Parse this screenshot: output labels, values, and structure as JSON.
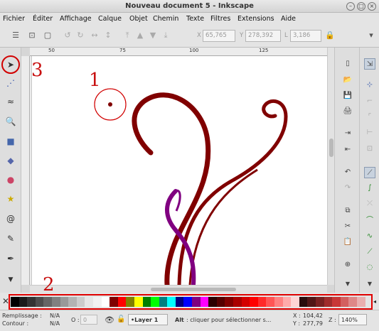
{
  "window": {
    "title": "Nouveau document 5 - Inkscape"
  },
  "menu": [
    "Fichier",
    "Éditer",
    "Affichage",
    "Calque",
    "Objet",
    "Chemin",
    "Texte",
    "Filtres",
    "Extensions",
    "Aide"
  ],
  "toolbar": {
    "x_label": "X",
    "x_value": "65,765",
    "y_label": "Y",
    "y_value": "278,392",
    "w_label": "L",
    "w_value": "3,186"
  },
  "ruler": {
    "ticks": [
      "50",
      "75",
      "100",
      "125"
    ]
  },
  "annotations": [
    "1",
    "2",
    "3"
  ],
  "palette": {
    "colors": [
      "#000000",
      "#1a1a1a",
      "#333333",
      "#4d4d4d",
      "#666666",
      "#808080",
      "#999999",
      "#b3b3b3",
      "#cccccc",
      "#e6e6e6",
      "#f2f2f2",
      "#ffffff",
      "#800000",
      "#ff0000",
      "#808000",
      "#ffff00",
      "#008000",
      "#00ff00",
      "#008080",
      "#00ffff",
      "#000080",
      "#0000ff",
      "#800080",
      "#ff00ff",
      "#2b0000",
      "#550000",
      "#800000",
      "#aa0000",
      "#d40000",
      "#ff0000",
      "#ff2a2a",
      "#ff5555",
      "#ff8080",
      "#ffaaaa",
      "#ffd5d5",
      "#280b0b",
      "#501616",
      "#782121",
      "#a02c2c",
      "#c83737",
      "#d35f5f",
      "#de8787",
      "#e9afaf"
    ]
  },
  "status": {
    "fill_label": "Remplissage :",
    "fill_value": "N/A",
    "stroke_label": "Contour :",
    "stroke_value": "N/A",
    "opacity_label": "O :",
    "opacity_value": "0",
    "layer": "•Layer 1",
    "hint_bold": "Alt",
    "hint": " : cliquer pour sélectionner s...",
    "x_label": "X :",
    "x_value": "104,42",
    "y_label": "Y :",
    "y_value": "277,79",
    "zoom_label": "Z :",
    "zoom_value": "140%"
  },
  "colors": {
    "accent_red": "#d10000",
    "swirl_dark_red": "#800000",
    "swirl_purple": "#800080"
  }
}
